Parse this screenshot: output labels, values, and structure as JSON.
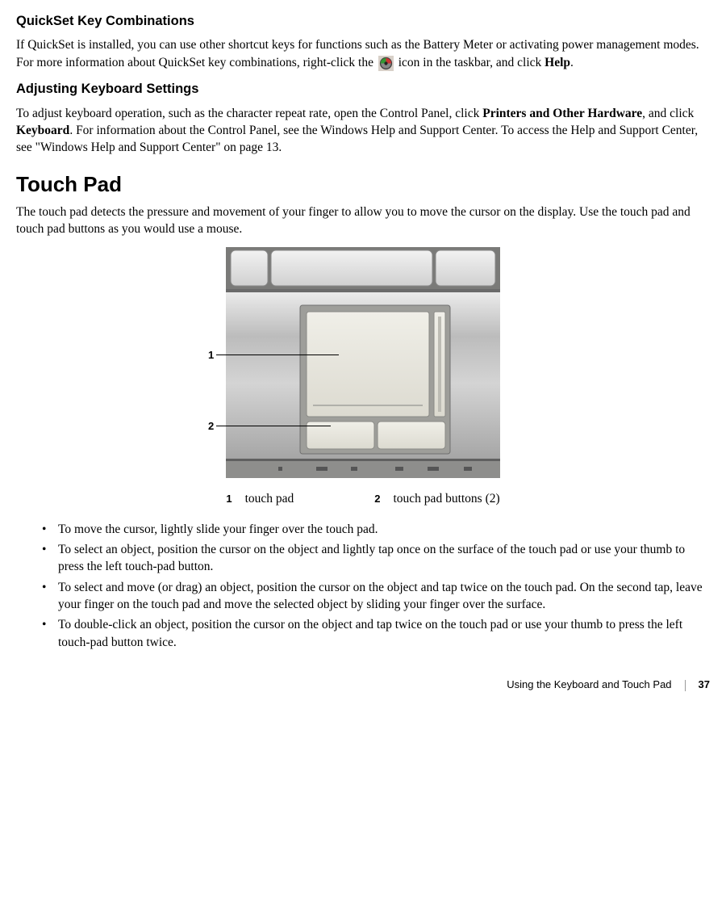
{
  "section1": {
    "heading": "QuickSet Key Combinations",
    "body_pre": "If QuickSet is installed, you can use other shortcut keys for functions such as the Battery Meter or activating power management modes. For more information about QuickSet key combinations, right-click the ",
    "body_post": " icon in the taskbar, and click ",
    "body_bold": "Help",
    "body_end": "."
  },
  "section2": {
    "heading": "Adjusting Keyboard Settings",
    "body_part1": "To adjust keyboard operation, such as the character repeat rate, open the Control Panel, click ",
    "bold1": "Printers and Other Hardware",
    "body_part2": ", and click ",
    "bold2": "Keyboard",
    "body_part3": ". For information about the Control Panel, see the Windows Help and Support Center. To access the Help and Support Center, see \"Windows Help and Support Center\" on page 13."
  },
  "section3": {
    "heading": "Touch Pad",
    "body": "The touch pad detects the pressure and movement of your finger to allow you to move the cursor on the display. Use the touch pad and touch pad buttons as you would use a mouse."
  },
  "figure": {
    "callout1": "1",
    "callout2": "2"
  },
  "legend": {
    "num1": "1",
    "label1": "touch pad",
    "num2": "2",
    "label2": "touch pad buttons (2)"
  },
  "instructions": [
    "To move the cursor, lightly slide your finger over the touch pad.",
    "To select an object, position the cursor on the object and lightly tap once on the surface of the touch pad or use your thumb to press the left touch-pad button.",
    "To select and move (or drag) an object, position the cursor on the object and tap twice on the touch pad. On the second tap, leave your finger on the touch pad and move the selected object by sliding your finger over the surface.",
    "To double-click an object, position the cursor on the object and tap twice on the touch pad or use your thumb to press the left touch-pad button twice."
  ],
  "footer": {
    "chapter": "Using the Keyboard and Touch Pad",
    "page": "37"
  }
}
